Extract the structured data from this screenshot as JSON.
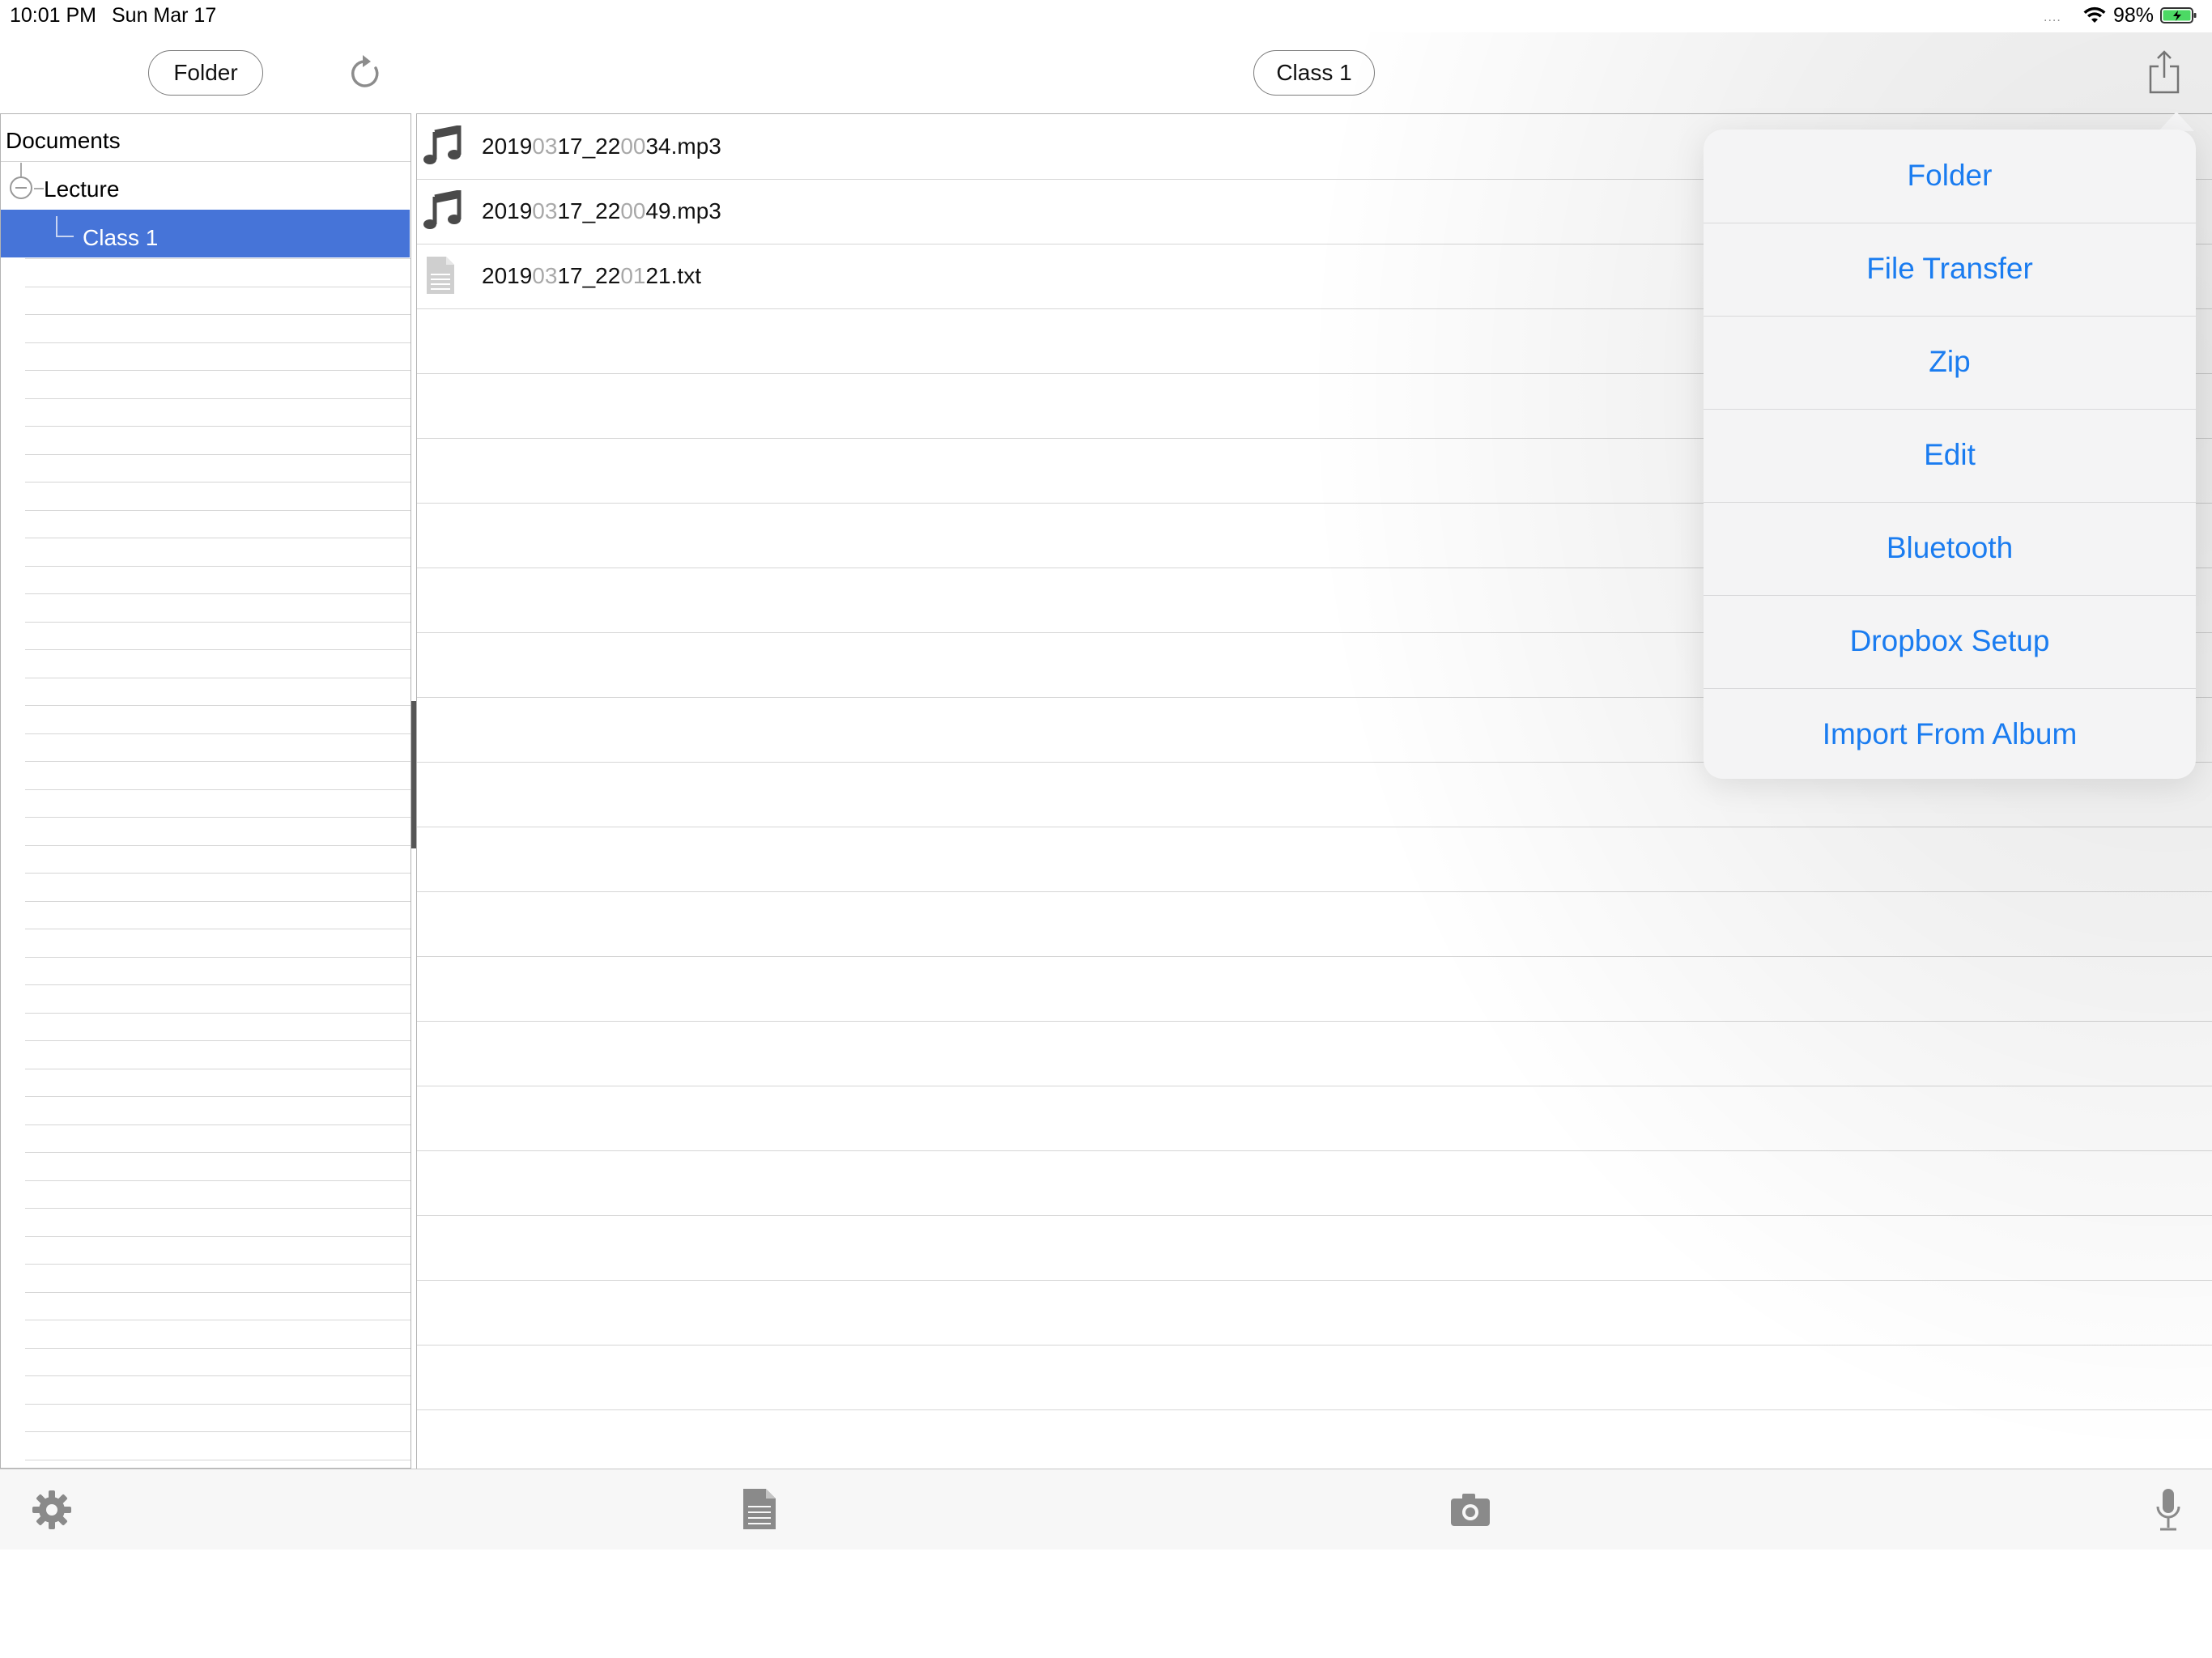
{
  "status_bar": {
    "time": "10:01 PM",
    "date": "Sun Mar 17",
    "dots": "....",
    "battery_percent": "98%"
  },
  "nav": {
    "folder_label": "Folder",
    "current_folder_label": "Class 1",
    "refresh_icon": "refresh-icon",
    "share_icon": "share-icon"
  },
  "tree": {
    "root": "Documents",
    "lecture": "Lecture",
    "selected": "Class 1"
  },
  "files": [
    {
      "parts": [
        "2019",
        "03",
        "17_22",
        "00",
        "34.mp3"
      ],
      "icon": "music-note-icon"
    },
    {
      "parts": [
        "2019",
        "03",
        "17_22",
        "00",
        "49.mp3"
      ],
      "icon": "music-note-icon"
    },
    {
      "parts": [
        "2019",
        "03",
        "17_22",
        "01",
        "21.txt"
      ],
      "icon": "text-document-icon"
    }
  ],
  "menu": {
    "items": [
      "Folder",
      "File Transfer",
      "Zip",
      "Edit",
      "Bluetooth",
      "Dropbox Setup",
      "Import From Album"
    ]
  },
  "toolbar": {
    "icons": [
      "gear-icon",
      "document-icon",
      "camera-icon",
      "microphone-icon"
    ]
  },
  "colors": {
    "selection": "#4674d8",
    "accent": "#1a7cf0",
    "muted_digits": "#a8a8a8"
  }
}
